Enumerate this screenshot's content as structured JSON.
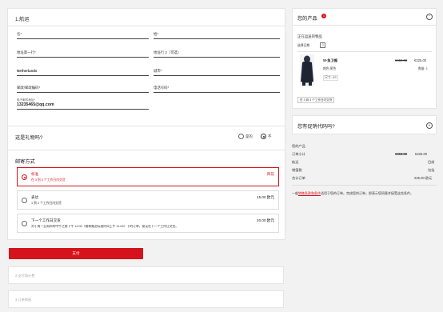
{
  "shipping": {
    "title": "1.航运",
    "fields": {
      "first_name": "名*",
      "last_name": "姓*",
      "address1": "地址第一行*",
      "address2": "地址行 2（可选）",
      "country": "Netherlands",
      "city": "城市*",
      "postal": "邮政/邮政编码*",
      "phone": "电话号码*",
      "email_label": "电子邮件地址*",
      "email_value": "13235465@qq.com"
    },
    "gift": {
      "question": "这是礼物吗?",
      "yes": "是的",
      "no": "不"
    },
    "method_title": "邮寄方式",
    "methods": [
      {
        "name": "标准",
        "desc": "在 3 到 3 个工作日内交货",
        "price": "目前"
      },
      {
        "name": "表达",
        "desc": "1 到 2 个工作日内交货",
        "price": "15.00 欧元"
      },
      {
        "name": "下一个工作日交货",
        "desc": "对于周一至周四的中午之前下午 12:00（格林威治标准时间上午 11:00）下的订单，保证在下一个工作日交货。",
        "price": "20.00 欧元"
      }
    ]
  },
  "actions": {
    "pay_button": "支付",
    "payment_step": "2.支付和计费",
    "review_step": "3.订单审阅"
  },
  "product_panel": {
    "title": "您的产品",
    "badge": "1",
    "collecting": "正在运送的物品",
    "ship_from": "选择日期",
    "product": {
      "name": "W-鱼卫帽",
      "price_old": "€450.00",
      "price_new": "€225.00",
      "color": "颜色:黑色",
      "qty": "数量: 1",
      "size": "尺寸: XS"
    },
    "delivery_note": "在 3 到 3 个工作日内交货"
  },
  "promo": {
    "title": "您有促销代码吗?",
    "plus": "+"
  },
  "summary": {
    "heading": "您的产品",
    "subtotal_label": "订单小计",
    "subtotal_old": "€450.00",
    "subtotal_new": "€225.00",
    "shipping_label": "航运",
    "shipping_value": "目前",
    "tax_label": "增值税",
    "tax_value": "包括",
    "total_label": "合计订单",
    "total_value": "225.00 欧元",
    "terms_prefix": "一般",
    "terms_link": "销售条款和条件",
    "terms_suffix": "适用于您的订单。完成您的订单，即表示您同意并接受这些条件。"
  },
  "colors": {
    "accent": "#d6131c",
    "background": "#f2f2f2"
  }
}
